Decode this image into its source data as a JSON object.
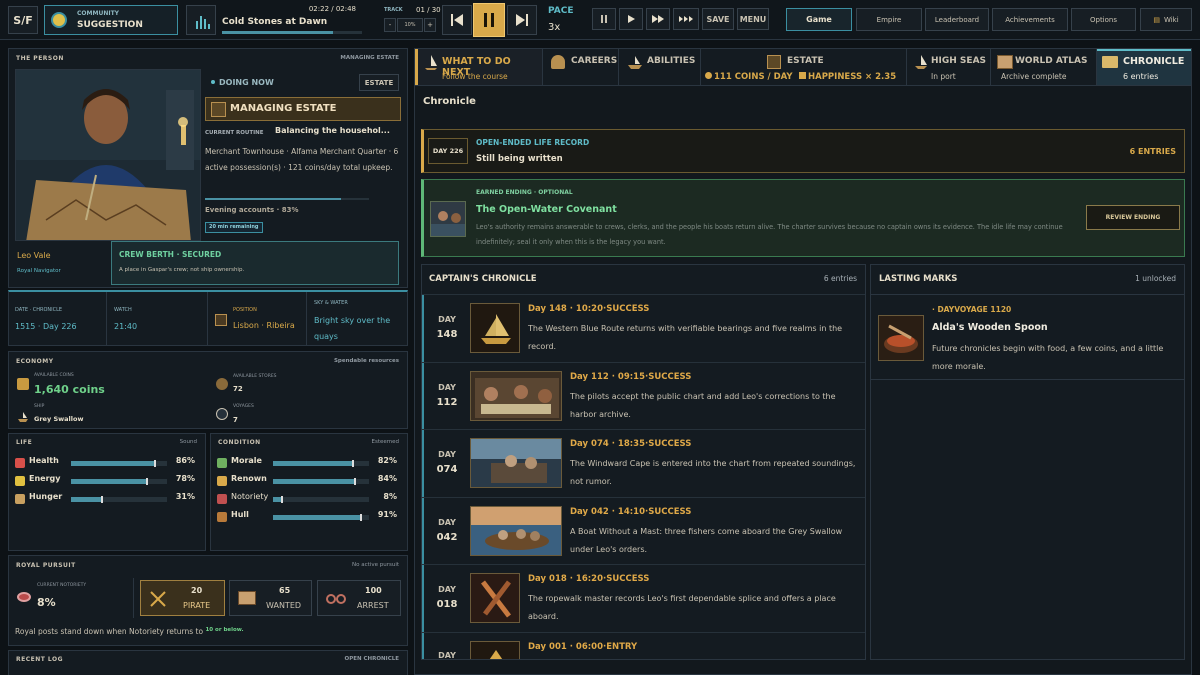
{
  "topbar": {
    "logo": "S/F",
    "mode_label": "COMMUNITY",
    "mode_value": "SUGGESTION",
    "time": "02:22 / 02:48",
    "track_title": "Cold Stones at Dawn",
    "track_label": "TRACK",
    "track_count": "01 / 30",
    "volume_minus": "-",
    "volume_value": "10%",
    "volume_plus": "+",
    "pace_label": "PACE",
    "pace_value": "3x",
    "save": "SAVE",
    "menu": "MENU",
    "nav": [
      "Game",
      "Empire",
      "Leaderboard",
      "Achievements",
      "Options",
      "Wiki"
    ],
    "track_progress": 0.79
  },
  "person": {
    "header": "THE PERSON",
    "header_right": "MANAGING ESTATE",
    "name": "Leo Vale",
    "title": "Royal Navigator",
    "doing_now": "DOING NOW",
    "doing_tag": "ESTATE",
    "activity": "MANAGING ESTATE",
    "routine_label": "CURRENT ROUTINE",
    "routine": "Balancing the househol...",
    "desc": "Merchant Townhouse · Alfama Merchant Quarter · 6 active possession(s) · 121 coins/day total upkeep.",
    "evening": "Evening accounts · 83%",
    "evening_pct": 0.83,
    "remaining": "20 min remaining",
    "berth_title": "CREW BERTH · SECURED",
    "berth_text": "A place in Gaspar's crew; not ship ownership."
  },
  "info": {
    "date_label": "DATE · CHRONICLE",
    "date": "1515 · Day 226",
    "watch_label": "WATCH",
    "watch": "21:40",
    "position_label": "POSITION",
    "position": "Lisbon · Ribeira",
    "sky_label": "SKY & WATER",
    "sky": "Bright sky over the quays"
  },
  "economy": {
    "header": "ECONOMY",
    "header_right": "Spendable resources",
    "coins_label": "AVAILABLE COINS",
    "coins": "1,640 coins",
    "stores_label": "AVAILABLE STORES",
    "stores": "72",
    "ship_label": "SHIP",
    "ship": "Grey Swallow",
    "voyages_label": "VOYAGES",
    "voyages": "7"
  },
  "life": {
    "header": "LIFE",
    "header_right": "Sound",
    "stats": [
      {
        "label": "Health",
        "value": "86%",
        "pct": 0.86
      },
      {
        "label": "Energy",
        "value": "78%",
        "pct": 0.78
      },
      {
        "label": "Hunger",
        "value": "31%",
        "pct": 0.31
      }
    ]
  },
  "condition": {
    "header": "CONDITION",
    "header_right": "Esteemed",
    "stats": [
      {
        "label": "Morale",
        "value": "82%",
        "pct": 0.82
      },
      {
        "label": "Renown",
        "value": "84%",
        "pct": 0.84
      },
      {
        "label": "Notoriety",
        "value": "8%",
        "pct": 0.08
      },
      {
        "label": "Hull",
        "value": "91%",
        "pct": 0.91
      }
    ]
  },
  "pursuit": {
    "header": "ROYAL PURSUIT",
    "header_right": "No active pursuit",
    "notoriety_label": "CURRENT NOTORIETY",
    "notoriety": "8%",
    "levels": [
      {
        "num": "20",
        "name": "PIRATE"
      },
      {
        "num": "65",
        "name": "WANTED"
      },
      {
        "num": "100",
        "name": "ARREST"
      }
    ],
    "note": "Royal posts stand down when Notoriety returns to",
    "note_em": "10 or below."
  },
  "log": {
    "header": "RECENT LOG",
    "header_right": "OPEN CHRONICLE"
  },
  "tabs": [
    {
      "title": "WHAT TO DO NEXT",
      "sub": "Follow the course"
    },
    {
      "title": "CAREERS",
      "sub": ""
    },
    {
      "title": "ABILITIES",
      "sub": ""
    },
    {
      "title": "ESTATE",
      "sub": "111 COINS / DAY",
      "sub2": "HAPPINESS × 2.35"
    },
    {
      "title": "HIGH SEAS",
      "sub": "In port"
    },
    {
      "title": "WORLD ATLAS",
      "sub": "Archive complete"
    },
    {
      "title": "CHRONICLE",
      "sub": "6 entries"
    }
  ],
  "chronicle": {
    "title": "Chronicle",
    "record_day": "DAY 226",
    "record_label": "OPEN-ENDED LIFE RECORD",
    "record_status": "Still being written",
    "record_count": "6 ENTRIES",
    "ending_label": "EARNED ENDING · OPTIONAL",
    "ending_title": "The Open-Water Covenant",
    "ending_text": "Leo's authority remains answerable to crews, clerks, and the people his boats return alive. The charter survives because no captain owns its evidence. The idle life may continue indefinitely; seal it only when this is the legacy you want.",
    "ending_button": "REVIEW ENDING",
    "captains_header": "CAPTAIN'S CHRONICLE",
    "captains_count": "6 entries",
    "entries": [
      {
        "day_label": "DAY",
        "day": "148",
        "head": "Day 148 · 10:20·SUCCESS",
        "text": "The Western Blue Route returns with verifiable bearings and five realms in the record."
      },
      {
        "day_label": "DAY",
        "day": "112",
        "head": "Day 112 · 09:15·SUCCESS",
        "text": "The pilots accept the public chart and add Leo's corrections to the harbor archive."
      },
      {
        "day_label": "DAY",
        "day": "074",
        "head": "Day 074 · 18:35·SUCCESS",
        "text": "The Windward Cape is entered into the chart from repeated soundings, not rumor."
      },
      {
        "day_label": "DAY",
        "day": "042",
        "head": "Day 042 · 14:10·SUCCESS",
        "text": "A Boat Without a Mast: three fishers come aboard the Grey Swallow under Leo's orders."
      },
      {
        "day_label": "DAY",
        "day": "018",
        "head": "Day 018 · 16:20·SUCCESS",
        "text": "The ropewalk master records Leo's first dependable splice and offers a place aboard."
      },
      {
        "day_label": "DAY",
        "day": "",
        "head": "Day 001 · 06:00·ENTRY",
        "text": ""
      }
    ],
    "marks_header": "LASTING MARKS",
    "marks_count": "1 unlocked",
    "mark_tag": "· DAYVOYAGE 1120",
    "mark_title": "Alda's Wooden Spoon",
    "mark_text": "Future chronicles begin with food, a few coins, and a little more morale."
  },
  "colors": {
    "accent": "#d9a94a",
    "teal": "#5fbcc8",
    "bar": "#4a92a4",
    "success": "#e0a948",
    "green": "#6fd18a"
  }
}
